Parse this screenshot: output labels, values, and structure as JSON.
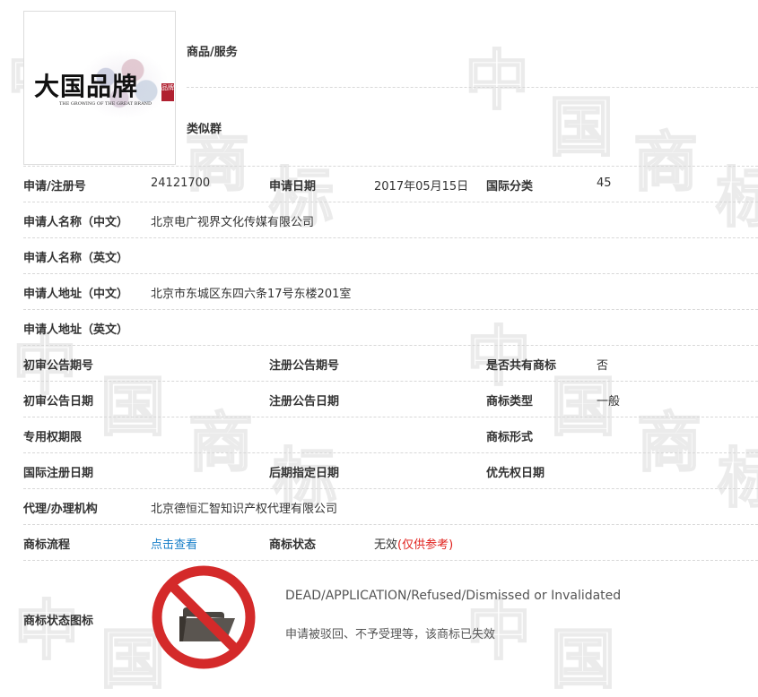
{
  "logo": {
    "main_text": "大国品牌",
    "sub_text": "THE GROWING OF THE GREAT BRAND",
    "seal_text": "品牌"
  },
  "labels": {
    "goods_services": "商品/服务",
    "similar_group": "类似群",
    "reg_no": "申请/注册号",
    "apply_date": "申请日期",
    "intl_class": "国际分类",
    "applicant_cn": "申请人名称（中文）",
    "applicant_en": "申请人名称（英文）",
    "address_cn": "申请人地址（中文）",
    "address_en": "申请人地址（英文）",
    "prelim_pub_no": "初审公告期号",
    "reg_pub_no": "注册公告期号",
    "shared_mark": "是否共有商标",
    "prelim_pub_date": "初审公告日期",
    "reg_pub_date": "注册公告日期",
    "mark_type": "商标类型",
    "exclusive_period": "专用权期限",
    "mark_form": "商标形式",
    "intl_reg_date": "国际注册日期",
    "late_designation_date": "后期指定日期",
    "priority_date": "优先权日期",
    "agent": "代理/办理机构",
    "process": "商标流程",
    "status": "商标状态",
    "status_icon": "商标状态图标"
  },
  "values": {
    "reg_no": "24121700",
    "apply_date": "2017年05月15日",
    "intl_class": "45",
    "applicant_cn": "北京电广视界文化传媒有限公司",
    "address_cn": "北京市东城区东四六条17号东楼201室",
    "shared_mark": "否",
    "mark_type": "一般",
    "agent": "北京德恒汇智知识产权代理有限公司",
    "process_link": "点击查看",
    "status": "无效",
    "status_note": "(仅供参考)",
    "status_en": "DEAD/APPLICATION/Refused/Dismissed or Invalidated",
    "status_cn_desc": "申请被驳回、不予受理等，该商标已失效"
  },
  "watermark": {
    "chars": [
      "中",
      "国",
      "商",
      "标"
    ]
  },
  "colors": {
    "link": "#1a80c9",
    "status_note": "#e0201c",
    "prohibition_ring": "#d42a2a",
    "folder": "#4a4540"
  },
  "icons": {
    "status_icon": "no-folder-icon"
  }
}
